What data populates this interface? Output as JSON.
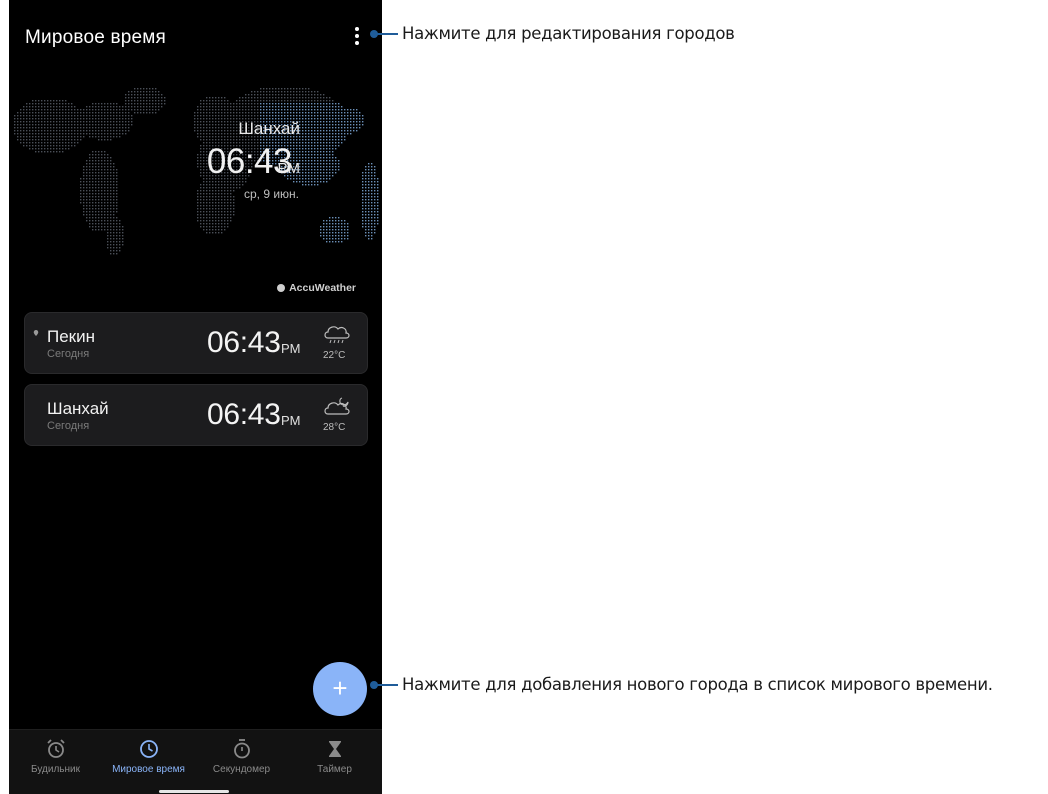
{
  "app": {
    "title": "Мировое время"
  },
  "hero": {
    "city": "Шанхай",
    "time": "06:43",
    "ampm": "PM",
    "date": "ср, 9 июн."
  },
  "attribution": "AccuWeather",
  "cities": [
    {
      "name": "Пекин",
      "day": "Сегодня",
      "time": "06:43",
      "ampm": "PM",
      "temp": "22°C",
      "weather_icon": "rain-cloud-icon",
      "pinned": true
    },
    {
      "name": "Шанхай",
      "day": "Сегодня",
      "time": "06:43",
      "ampm": "PM",
      "temp": "28°C",
      "weather_icon": "partly-cloudy-night-icon",
      "pinned": false
    }
  ],
  "fab": {
    "label": "+"
  },
  "nav": [
    {
      "label": "Будильник",
      "icon": "alarm-clock-icon",
      "active": false
    },
    {
      "label": "Мировое время",
      "icon": "clock-icon",
      "active": true
    },
    {
      "label": "Секундомер",
      "icon": "stopwatch-icon",
      "active": false
    },
    {
      "label": "Таймер",
      "icon": "hourglass-icon",
      "active": false
    }
  ],
  "callouts": {
    "edit": "Нажмите для редактирования городов",
    "add": "Нажмите для добавления нового города в список мирового времени."
  },
  "colors": {
    "accent": "#8ab4f8",
    "callout": "#1f5c99",
    "card_bg": "#1c1c1e",
    "background": "#000000"
  }
}
